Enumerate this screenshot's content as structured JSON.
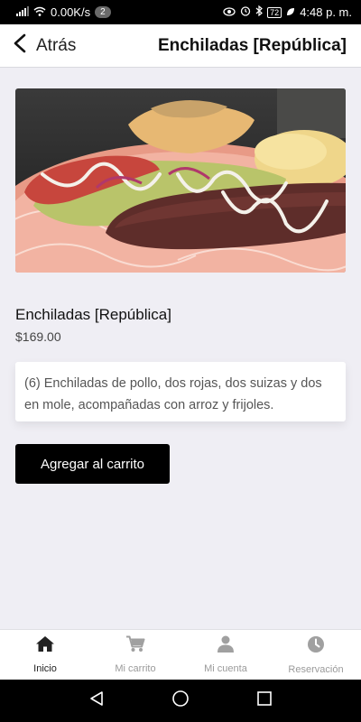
{
  "status_bar": {
    "net_speed": "0.00K/s",
    "notif_count": "2",
    "battery": "72",
    "time": "4:48 p. m."
  },
  "header": {
    "back_label": "Atrás",
    "title": "Enchiladas [República]"
  },
  "product": {
    "name": "Enchiladas [República]",
    "price": "$169.00",
    "description": "(6) Enchiladas de pollo, dos rojas, dos suizas y dos en mole, acompañadas con arroz y frijoles.",
    "add_button": "Agregar al carrito"
  },
  "bottom_nav": {
    "items": [
      {
        "label": "Inicio",
        "icon": "home-icon",
        "active": true
      },
      {
        "label": "Mi carrito",
        "icon": "cart-icon",
        "active": false
      },
      {
        "label": "Mi cuenta",
        "icon": "user-icon",
        "active": false
      },
      {
        "label": "Reservación",
        "icon": "clock-icon",
        "active": false
      }
    ]
  },
  "colors": {
    "background": "#efeef4",
    "button": "#000000",
    "nav_active": "#222222",
    "nav_inactive": "#9a9a9a"
  }
}
